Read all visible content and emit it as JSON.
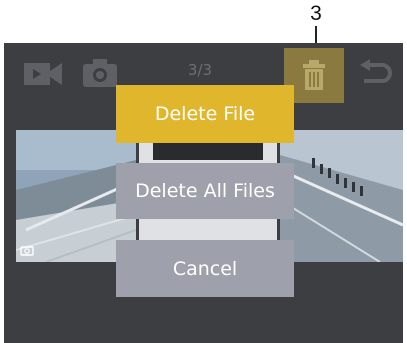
{
  "callout": {
    "number": "3"
  },
  "topbar": {
    "counter": "3/3",
    "icons": [
      "video-camera-icon",
      "photo-camera-icon",
      "trash-icon",
      "back-arrow-icon"
    ]
  },
  "dialog": {
    "delete_file": "Delete File",
    "delete_all_files": "Delete All Files",
    "cancel": "Cancel"
  },
  "colors": {
    "screen_bg": "#3d3e42",
    "selected_button": "#e0b62c",
    "button": "#9ea1ab",
    "trash_highlight": "#8a7a40"
  }
}
